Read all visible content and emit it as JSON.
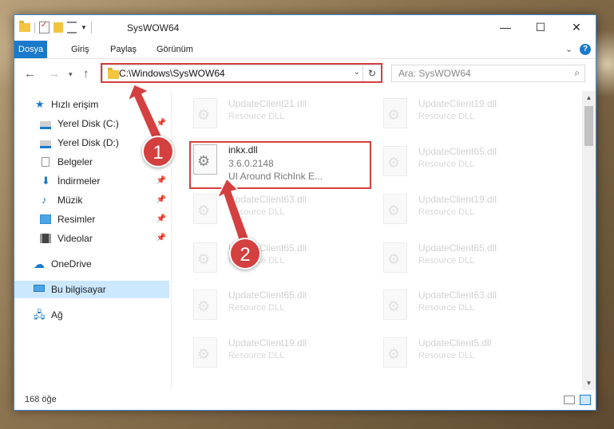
{
  "window": {
    "title": "SysWOW64",
    "controls": {
      "minimize": "—",
      "maximize": "☐",
      "close": "✕"
    }
  },
  "ribbon": {
    "tabs": [
      {
        "label": "Dosya"
      },
      {
        "label": "Giriş"
      },
      {
        "label": "Paylaş"
      },
      {
        "label": "Görünüm"
      }
    ],
    "help": "?"
  },
  "navigation": {
    "address": "C:\\Windows\\SysWOW64",
    "search_placeholder": "Ara: SysWOW64"
  },
  "sidebar": {
    "items": [
      {
        "label": "Hızlı erişim",
        "icon": "star-icon"
      },
      {
        "label": "Yerel Disk (C:)",
        "icon": "drive-icon",
        "pinned": true
      },
      {
        "label": "Yerel Disk (D:)",
        "icon": "drive-icon"
      },
      {
        "label": "Belgeler",
        "icon": "document-icon",
        "pinned": true
      },
      {
        "label": "İndirmeler",
        "icon": "download-icon",
        "pinned": true
      },
      {
        "label": "Müzik",
        "icon": "music-icon",
        "pinned": true
      },
      {
        "label": "Resimler",
        "icon": "pictures-icon",
        "pinned": true
      },
      {
        "label": "Videolar",
        "icon": "video-icon",
        "pinned": true
      },
      {
        "label": "OneDrive",
        "icon": "cloud-icon"
      },
      {
        "label": "Bu bilgisayar",
        "icon": "computer-icon",
        "selected": true
      },
      {
        "label": "Ağ",
        "icon": "network-icon"
      }
    ]
  },
  "files": {
    "left": [
      {
        "name": "UpdateClient21.dll",
        "type": "Resource DLL"
      },
      {
        "name": "inkx.dll",
        "version": "3.6.0.2148",
        "description": "UI Around RichInk E..."
      },
      {
        "name": "UpdateClient63.dll",
        "type": "Resource DLL"
      },
      {
        "name": "UpdateClient65.dll",
        "type": "Resource DLL"
      },
      {
        "name": "UpdateClient65.dll",
        "type": "Resource DLL"
      },
      {
        "name": "UpdateClient19.dll",
        "type": "Resource DLL"
      }
    ],
    "right": [
      {
        "name": "UpdateClient19.dll",
        "type": "Resource DLL"
      },
      {
        "name": "UpdateClient65.dll",
        "type": "Resource DLL"
      },
      {
        "name": "UpdateClient19.dll",
        "type": "Resource DLL"
      },
      {
        "name": "UpdateClient65.dll",
        "type": "Resource DLL"
      },
      {
        "name": "UpdateClient63.dll",
        "type": "Resource DLL"
      },
      {
        "name": "UpdateClient5.dll",
        "type": "Resource DLL"
      }
    ]
  },
  "status": {
    "count": "168 öğe"
  },
  "callouts": {
    "one": "1",
    "two": "2"
  },
  "colors": {
    "accent": "#1979ca",
    "highlight": "#d43f3f"
  }
}
